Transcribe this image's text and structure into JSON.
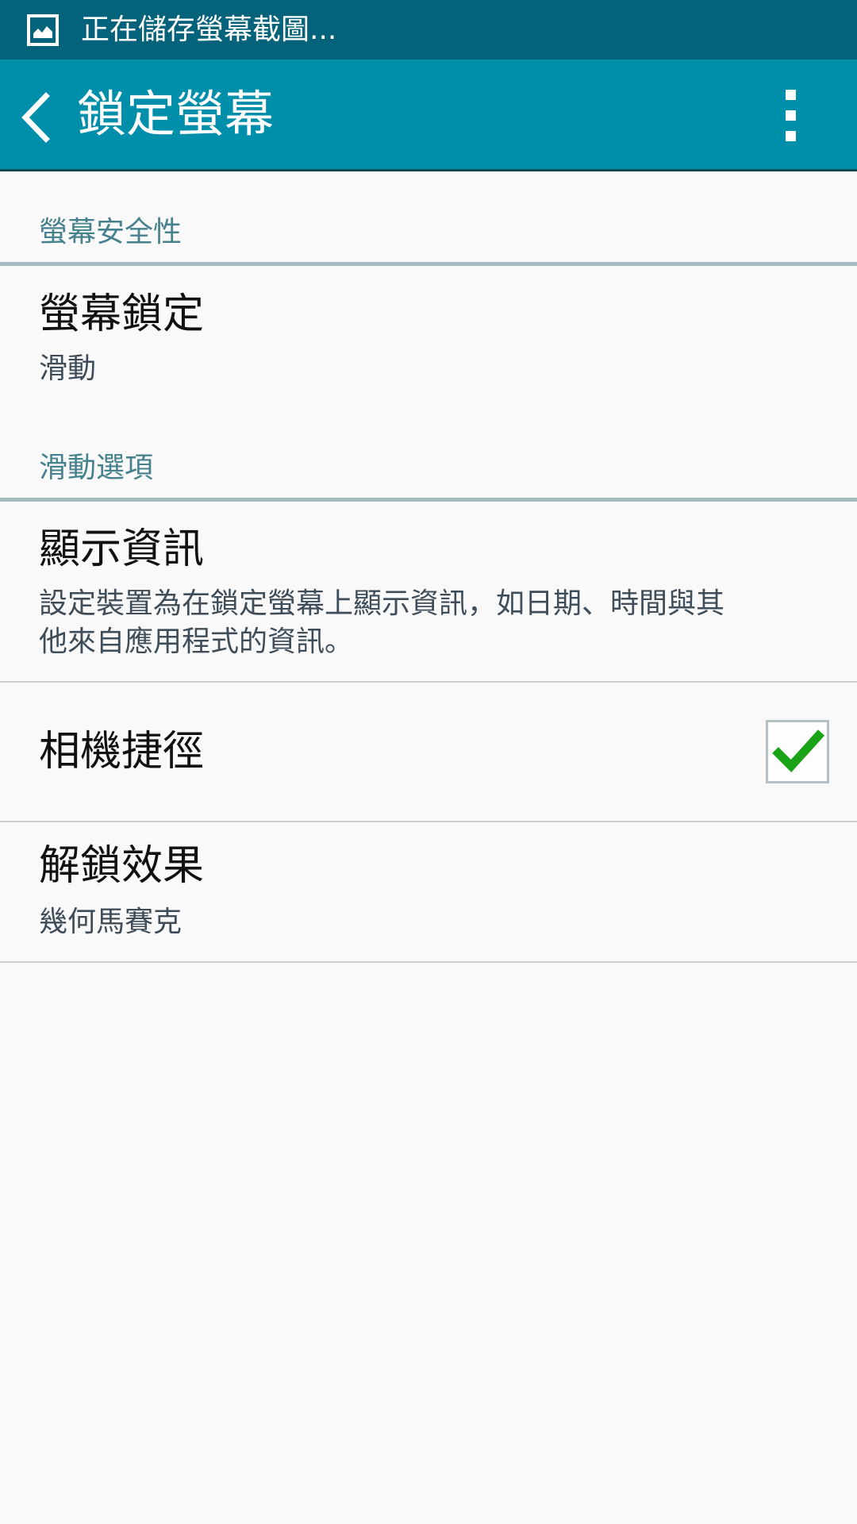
{
  "status_bar": {
    "notification_text": "正在儲存螢幕截圖..."
  },
  "action_bar": {
    "title": "鎖定螢幕"
  },
  "sections": {
    "screen_security": {
      "header": "螢幕安全性",
      "screen_lock": {
        "title": "螢幕鎖定",
        "summary": "滑動"
      }
    },
    "swipe_options": {
      "header": "滑動選項",
      "show_info": {
        "title": "顯示資訊",
        "summary_line1": "設定裝置為在鎖定螢幕上顯示資訊，如日期、時間與其",
        "summary_line2": "他來自應用程式的資訊。"
      },
      "camera_shortcut": {
        "title": "相機捷徑",
        "checked": true
      },
      "unlock_effect": {
        "title": "解鎖效果",
        "summary": "幾何馬賽克"
      }
    }
  },
  "colors": {
    "status_bar": "#04627a",
    "action_bar": "#008fab",
    "section_header_text": "#46818e",
    "checkmark": "#1aa317"
  }
}
